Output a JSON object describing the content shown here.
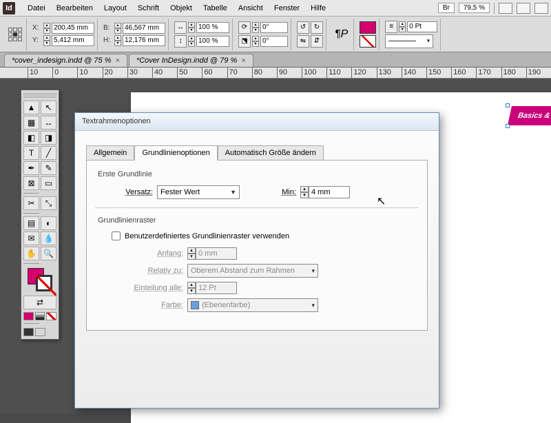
{
  "app": {
    "name": "Id"
  },
  "menu": [
    "Datei",
    "Bearbeiten",
    "Layout",
    "Schrift",
    "Objekt",
    "Tabelle",
    "Ansicht",
    "Fenster",
    "Hilfe"
  ],
  "menubar_right": {
    "bridge_label": "Br",
    "zoom": "79,5 %"
  },
  "control": {
    "x": "200,45 mm",
    "y": "5,412 mm",
    "w": "46,567 mm",
    "h": "12,176 mm",
    "scale_x": "100 %",
    "scale_y": "100 %",
    "rotate": "0°",
    "shear": "0°",
    "stroke_weight": "0 Pt"
  },
  "tabs": [
    {
      "label": "*cover_indesign.indd @ 75 %"
    },
    {
      "label": "*Cover InDesign.indd @ 79 %"
    }
  ],
  "ruler_marks": [
    "10",
    "0",
    "10",
    "20",
    "30",
    "40",
    "50",
    "60",
    "70",
    "80",
    "90",
    "100",
    "110",
    "120",
    "130",
    "140",
    "150",
    "160",
    "170",
    "180",
    "190"
  ],
  "page_object_text": "Basics &",
  "dialog": {
    "title": "Textrahmenoptionen",
    "tabs": [
      "Allgemein",
      "Grundlinienoptionen",
      "Automatisch Größe ändern"
    ],
    "active_tab": 1,
    "first_baseline": {
      "legend": "Erste Grundlinie",
      "offset_label": "Versatz:",
      "offset_value": "Fester Wert",
      "min_label": "Min:",
      "min_value": "4 mm"
    },
    "baseline_grid": {
      "legend": "Grundlinienraster",
      "checkbox_label": "Benutzerdefiniertes Grundlinienraster verwenden",
      "checkbox_checked": false,
      "start_label": "Anfang:",
      "start_value": "0 mm",
      "relative_label": "Relativ zu:",
      "relative_value": "Oberem Abstand zum Rahmen",
      "increment_label": "Einteilung alle:",
      "increment_value": "12 Pt",
      "color_label": "Farbe:",
      "color_value": "(Ebenenfarbe)"
    }
  }
}
